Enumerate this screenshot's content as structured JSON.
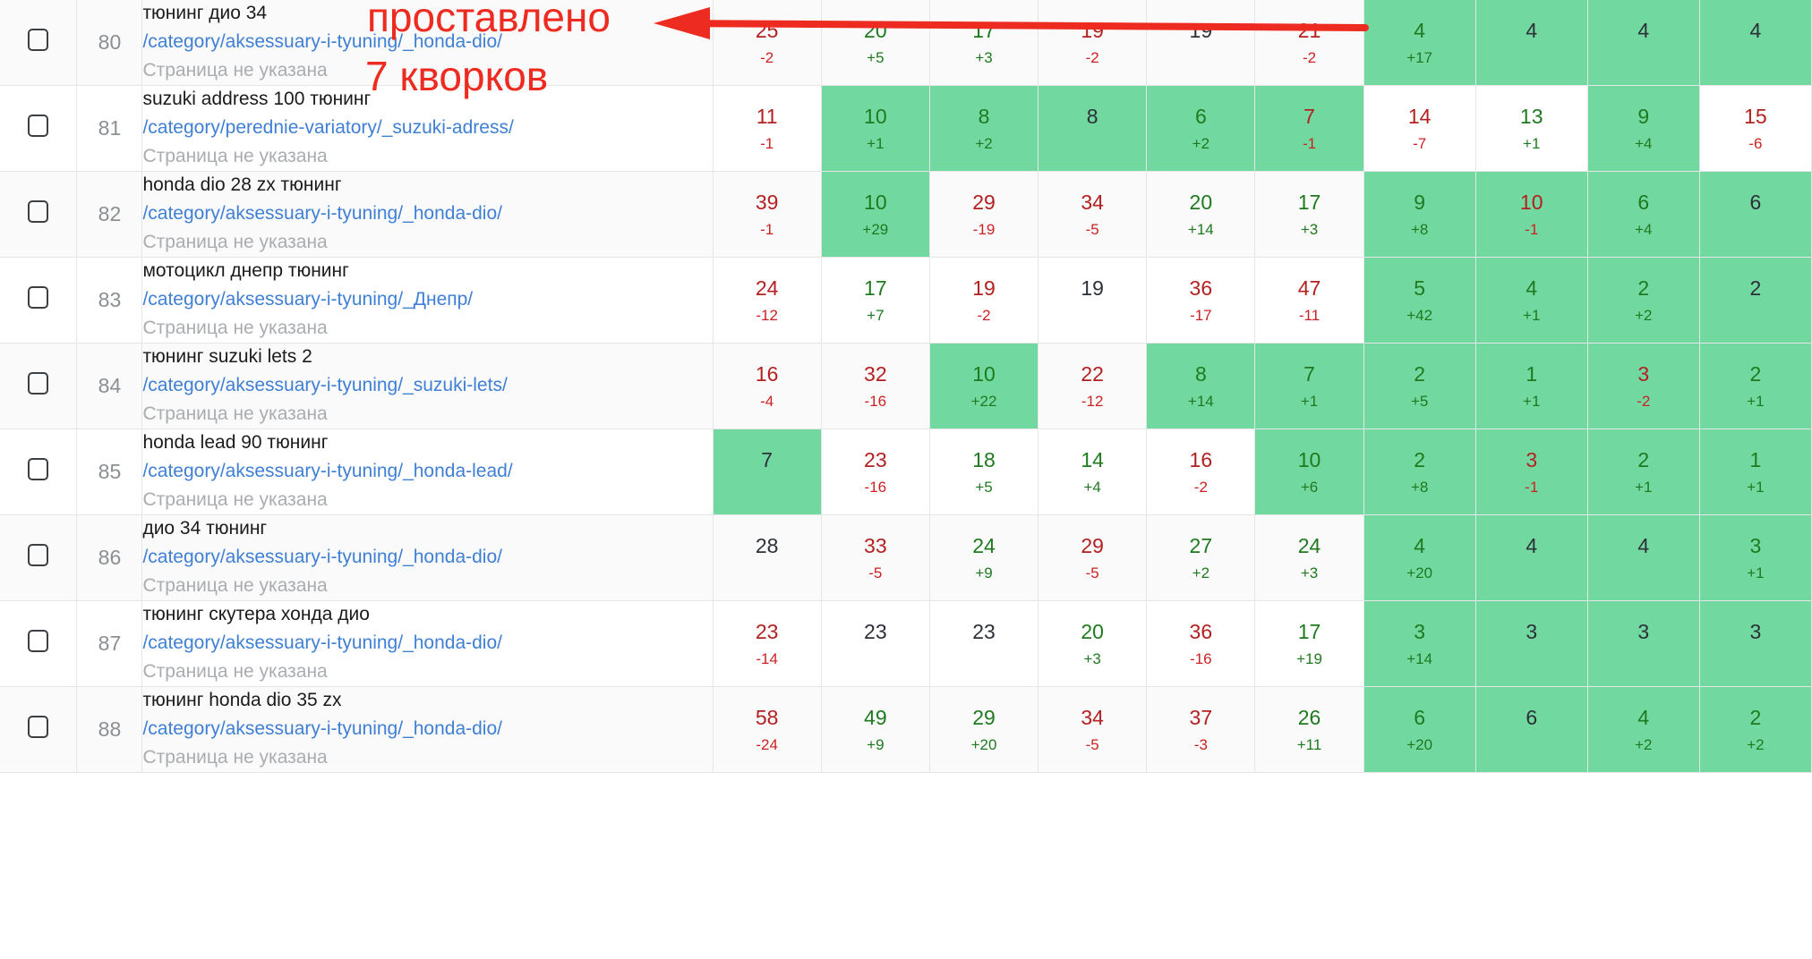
{
  "table": {
    "columns": [
      {
        "key": "checkbox",
        "type": "checkbox"
      },
      {
        "key": "index",
        "type": "number"
      },
      {
        "key": "keyword",
        "type": "text"
      },
      {
        "key": "m1",
        "type": "metric"
      },
      {
        "key": "m2",
        "type": "metric"
      },
      {
        "key": "m3",
        "type": "metric"
      },
      {
        "key": "m4",
        "type": "metric"
      },
      {
        "key": "m5",
        "type": "metric"
      },
      {
        "key": "m6",
        "type": "metric"
      },
      {
        "key": "m7",
        "type": "metric"
      },
      {
        "key": "m8",
        "type": "metric"
      },
      {
        "key": "m9",
        "type": "metric"
      },
      {
        "key": "m10",
        "type": "metric"
      }
    ],
    "page_note_text": "Страница не указана",
    "rows": [
      {
        "index": "80",
        "phrase": "тюнинг дио 34",
        "url": "/category/aksessuary-i-tyuning/_honda-dio/",
        "note": "Страница не указана",
        "metrics": [
          {
            "value": "25",
            "delta": "-2",
            "tone": "neg",
            "delta_tone": "neg",
            "hl": false
          },
          {
            "value": "20",
            "delta": "+5",
            "tone": "pos",
            "delta_tone": "pos",
            "hl": false
          },
          {
            "value": "17",
            "delta": "+3",
            "tone": "pos",
            "delta_tone": "pos",
            "hl": false
          },
          {
            "value": "19",
            "delta": "-2",
            "tone": "neg",
            "delta_tone": "neg",
            "hl": false
          },
          {
            "value": "19",
            "delta": "",
            "tone": "neu",
            "delta_tone": "",
            "hl": false
          },
          {
            "value": "21",
            "delta": "-2",
            "tone": "neg",
            "delta_tone": "neg",
            "hl": false
          },
          {
            "value": "4",
            "delta": "+17",
            "tone": "pos",
            "delta_tone": "pos",
            "hl": true
          },
          {
            "value": "4",
            "delta": "",
            "tone": "neu",
            "delta_tone": "",
            "hl": true
          },
          {
            "value": "4",
            "delta": "",
            "tone": "neu",
            "delta_tone": "",
            "hl": true
          },
          {
            "value": "4",
            "delta": "",
            "tone": "neu",
            "delta_tone": "",
            "hl": true
          }
        ]
      },
      {
        "index": "81",
        "phrase": "suzuki address 100 тюнинг",
        "url": "/category/perednie-variatory/_suzuki-adress/",
        "note": "Страница не указана",
        "metrics": [
          {
            "value": "11",
            "delta": "-1",
            "tone": "neg",
            "delta_tone": "neg",
            "hl": false
          },
          {
            "value": "10",
            "delta": "+1",
            "tone": "pos",
            "delta_tone": "pos",
            "hl": true
          },
          {
            "value": "8",
            "delta": "+2",
            "tone": "pos",
            "delta_tone": "pos",
            "hl": true
          },
          {
            "value": "8",
            "delta": "",
            "tone": "neu",
            "delta_tone": "",
            "hl": true
          },
          {
            "value": "6",
            "delta": "+2",
            "tone": "pos",
            "delta_tone": "pos",
            "hl": true
          },
          {
            "value": "7",
            "delta": "-1",
            "tone": "neg",
            "delta_tone": "neg",
            "hl": true
          },
          {
            "value": "14",
            "delta": "-7",
            "tone": "neg",
            "delta_tone": "neg",
            "hl": false
          },
          {
            "value": "13",
            "delta": "+1",
            "tone": "pos",
            "delta_tone": "pos",
            "hl": false
          },
          {
            "value": "9",
            "delta": "+4",
            "tone": "pos",
            "delta_tone": "pos",
            "hl": true
          },
          {
            "value": "15",
            "delta": "-6",
            "tone": "neg",
            "delta_tone": "neg",
            "hl": false
          }
        ]
      },
      {
        "index": "82",
        "phrase": "honda dio 28 zx тюнинг",
        "url": "/category/aksessuary-i-tyuning/_honda-dio/",
        "note": "Страница не указана",
        "metrics": [
          {
            "value": "39",
            "delta": "-1",
            "tone": "neg",
            "delta_tone": "neg",
            "hl": false
          },
          {
            "value": "10",
            "delta": "+29",
            "tone": "pos",
            "delta_tone": "pos",
            "hl": true
          },
          {
            "value": "29",
            "delta": "-19",
            "tone": "neg",
            "delta_tone": "neg",
            "hl": false
          },
          {
            "value": "34",
            "delta": "-5",
            "tone": "neg",
            "delta_tone": "neg",
            "hl": false
          },
          {
            "value": "20",
            "delta": "+14",
            "tone": "pos",
            "delta_tone": "pos",
            "hl": false
          },
          {
            "value": "17",
            "delta": "+3",
            "tone": "pos",
            "delta_tone": "pos",
            "hl": false
          },
          {
            "value": "9",
            "delta": "+8",
            "tone": "pos",
            "delta_tone": "pos",
            "hl": true
          },
          {
            "value": "10",
            "delta": "-1",
            "tone": "neg",
            "delta_tone": "neg",
            "hl": true
          },
          {
            "value": "6",
            "delta": "+4",
            "tone": "pos",
            "delta_tone": "pos",
            "hl": true
          },
          {
            "value": "6",
            "delta": "",
            "tone": "neu",
            "delta_tone": "",
            "hl": true
          }
        ]
      },
      {
        "index": "83",
        "phrase": "мотоцикл днепр тюнинг",
        "url": "/category/aksessuary-i-tyuning/_Днепр/",
        "note": "Страница не указана",
        "metrics": [
          {
            "value": "24",
            "delta": "-12",
            "tone": "neg",
            "delta_tone": "neg",
            "hl": false
          },
          {
            "value": "17",
            "delta": "+7",
            "tone": "pos",
            "delta_tone": "pos",
            "hl": false
          },
          {
            "value": "19",
            "delta": "-2",
            "tone": "neg",
            "delta_tone": "neg",
            "hl": false
          },
          {
            "value": "19",
            "delta": "",
            "tone": "neu",
            "delta_tone": "",
            "hl": false
          },
          {
            "value": "36",
            "delta": "-17",
            "tone": "neg",
            "delta_tone": "neg",
            "hl": false
          },
          {
            "value": "47",
            "delta": "-11",
            "tone": "neg",
            "delta_tone": "neg",
            "hl": false
          },
          {
            "value": "5",
            "delta": "+42",
            "tone": "pos",
            "delta_tone": "pos",
            "hl": true
          },
          {
            "value": "4",
            "delta": "+1",
            "tone": "pos",
            "delta_tone": "pos",
            "hl": true
          },
          {
            "value": "2",
            "delta": "+2",
            "tone": "pos",
            "delta_tone": "pos",
            "hl": true
          },
          {
            "value": "2",
            "delta": "",
            "tone": "neu",
            "delta_tone": "",
            "hl": true
          }
        ]
      },
      {
        "index": "84",
        "phrase": "тюнинг suzuki lets 2",
        "url": "/category/aksessuary-i-tyuning/_suzuki-lets/",
        "note": "Страница не указана",
        "metrics": [
          {
            "value": "16",
            "delta": "-4",
            "tone": "neg",
            "delta_tone": "neg",
            "hl": false
          },
          {
            "value": "32",
            "delta": "-16",
            "tone": "neg",
            "delta_tone": "neg",
            "hl": false
          },
          {
            "value": "10",
            "delta": "+22",
            "tone": "pos",
            "delta_tone": "pos",
            "hl": true
          },
          {
            "value": "22",
            "delta": "-12",
            "tone": "neg",
            "delta_tone": "neg",
            "hl": false
          },
          {
            "value": "8",
            "delta": "+14",
            "tone": "pos",
            "delta_tone": "pos",
            "hl": true
          },
          {
            "value": "7",
            "delta": "+1",
            "tone": "pos",
            "delta_tone": "pos",
            "hl": true
          },
          {
            "value": "2",
            "delta": "+5",
            "tone": "pos",
            "delta_tone": "pos",
            "hl": true
          },
          {
            "value": "1",
            "delta": "+1",
            "tone": "pos",
            "delta_tone": "pos",
            "hl": true
          },
          {
            "value": "3",
            "delta": "-2",
            "tone": "neg",
            "delta_tone": "neg",
            "hl": true
          },
          {
            "value": "2",
            "delta": "+1",
            "tone": "pos",
            "delta_tone": "pos",
            "hl": true
          }
        ]
      },
      {
        "index": "85",
        "phrase": "honda lead 90 тюнинг",
        "url": "/category/aksessuary-i-tyuning/_honda-lead/",
        "note": "Страница не указана",
        "metrics": [
          {
            "value": "7",
            "delta": "",
            "tone": "neu",
            "delta_tone": "",
            "hl": true
          },
          {
            "value": "23",
            "delta": "-16",
            "tone": "neg",
            "delta_tone": "neg",
            "hl": false
          },
          {
            "value": "18",
            "delta": "+5",
            "tone": "pos",
            "delta_tone": "pos",
            "hl": false
          },
          {
            "value": "14",
            "delta": "+4",
            "tone": "pos",
            "delta_tone": "pos",
            "hl": false
          },
          {
            "value": "16",
            "delta": "-2",
            "tone": "neg",
            "delta_tone": "neg",
            "hl": false
          },
          {
            "value": "10",
            "delta": "+6",
            "tone": "pos",
            "delta_tone": "pos",
            "hl": true
          },
          {
            "value": "2",
            "delta": "+8",
            "tone": "pos",
            "delta_tone": "pos",
            "hl": true
          },
          {
            "value": "3",
            "delta": "-1",
            "tone": "neg",
            "delta_tone": "neg",
            "hl": true
          },
          {
            "value": "2",
            "delta": "+1",
            "tone": "pos",
            "delta_tone": "pos",
            "hl": true
          },
          {
            "value": "1",
            "delta": "+1",
            "tone": "pos",
            "delta_tone": "pos",
            "hl": true
          }
        ]
      },
      {
        "index": "86",
        "phrase": "дио 34 тюнинг",
        "url": "/category/aksessuary-i-tyuning/_honda-dio/",
        "note": "Страница не указана",
        "metrics": [
          {
            "value": "28",
            "delta": "",
            "tone": "neu",
            "delta_tone": "",
            "hl": false
          },
          {
            "value": "33",
            "delta": "-5",
            "tone": "neg",
            "delta_tone": "neg",
            "hl": false
          },
          {
            "value": "24",
            "delta": "+9",
            "tone": "pos",
            "delta_tone": "pos",
            "hl": false
          },
          {
            "value": "29",
            "delta": "-5",
            "tone": "neg",
            "delta_tone": "neg",
            "hl": false
          },
          {
            "value": "27",
            "delta": "+2",
            "tone": "pos",
            "delta_tone": "pos",
            "hl": false
          },
          {
            "value": "24",
            "delta": "+3",
            "tone": "pos",
            "delta_tone": "pos",
            "hl": false
          },
          {
            "value": "4",
            "delta": "+20",
            "tone": "pos",
            "delta_tone": "pos",
            "hl": true
          },
          {
            "value": "4",
            "delta": "",
            "tone": "neu",
            "delta_tone": "",
            "hl": true
          },
          {
            "value": "4",
            "delta": "",
            "tone": "neu",
            "delta_tone": "",
            "hl": true
          },
          {
            "value": "3",
            "delta": "+1",
            "tone": "pos",
            "delta_tone": "pos",
            "hl": true
          }
        ]
      },
      {
        "index": "87",
        "phrase": "тюнинг скутера хонда дио",
        "url": "/category/aksessuary-i-tyuning/_honda-dio/",
        "note": "Страница не указана",
        "metrics": [
          {
            "value": "23",
            "delta": "-14",
            "tone": "neg",
            "delta_tone": "neg",
            "hl": false
          },
          {
            "value": "23",
            "delta": "",
            "tone": "neu",
            "delta_tone": "",
            "hl": false
          },
          {
            "value": "23",
            "delta": "",
            "tone": "neu",
            "delta_tone": "",
            "hl": false
          },
          {
            "value": "20",
            "delta": "+3",
            "tone": "pos",
            "delta_tone": "pos",
            "hl": false
          },
          {
            "value": "36",
            "delta": "-16",
            "tone": "neg",
            "delta_tone": "neg",
            "hl": false
          },
          {
            "value": "17",
            "delta": "+19",
            "tone": "pos",
            "delta_tone": "pos",
            "hl": false
          },
          {
            "value": "3",
            "delta": "+14",
            "tone": "pos",
            "delta_tone": "pos",
            "hl": true
          },
          {
            "value": "3",
            "delta": "",
            "tone": "neu",
            "delta_tone": "",
            "hl": true
          },
          {
            "value": "3",
            "delta": "",
            "tone": "neu",
            "delta_tone": "",
            "hl": true
          },
          {
            "value": "3",
            "delta": "",
            "tone": "neu",
            "delta_tone": "",
            "hl": true
          }
        ]
      },
      {
        "index": "88",
        "phrase": "тюнинг honda dio 35 zx",
        "url": "/category/aksessuary-i-tyuning/_honda-dio/",
        "note": "Страница не указана",
        "metrics": [
          {
            "value": "58",
            "delta": "-24",
            "tone": "neg",
            "delta_tone": "neg",
            "hl": false
          },
          {
            "value": "49",
            "delta": "+9",
            "tone": "pos",
            "delta_tone": "pos",
            "hl": false
          },
          {
            "value": "29",
            "delta": "+20",
            "tone": "pos",
            "delta_tone": "pos",
            "hl": false
          },
          {
            "value": "34",
            "delta": "-5",
            "tone": "neg",
            "delta_tone": "neg",
            "hl": false
          },
          {
            "value": "37",
            "delta": "-3",
            "tone": "neg",
            "delta_tone": "neg",
            "hl": false
          },
          {
            "value": "26",
            "delta": "+11",
            "tone": "pos",
            "delta_tone": "pos",
            "hl": false
          },
          {
            "value": "6",
            "delta": "+20",
            "tone": "pos",
            "delta_tone": "pos",
            "hl": true
          },
          {
            "value": "6",
            "delta": "",
            "tone": "neu",
            "delta_tone": "",
            "hl": true
          },
          {
            "value": "4",
            "delta": "+2",
            "tone": "pos",
            "delta_tone": "pos",
            "hl": true
          },
          {
            "value": "2",
            "delta": "+2",
            "tone": "pos",
            "delta_tone": "pos",
            "hl": true
          }
        ]
      }
    ]
  },
  "annotation": {
    "label_top": "проставлено",
    "label_bottom": "7 кворков",
    "color": "#ee2b20"
  },
  "colors": {
    "highlight_green": "#71d8a0",
    "link_blue": "#3f7fd4",
    "positive_green": "#1f7a1f",
    "negative_red": "#b32020",
    "muted_grey": "#a9adb1",
    "annotation_red": "#ee2b20"
  }
}
